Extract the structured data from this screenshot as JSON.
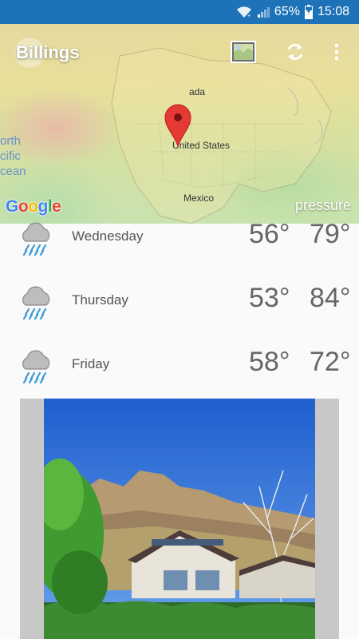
{
  "status_bar": {
    "battery_percent": "65%",
    "time": "15:08",
    "bg_color": "#1e73b8"
  },
  "map": {
    "city": "Billings",
    "labels": {
      "canada": "ada",
      "us": "United States",
      "mexico": "Mexico",
      "ocean_line1": "orth",
      "ocean_line2": "cific",
      "ocean_line3": "cean"
    },
    "google": "Google",
    "layer": "pressure",
    "icons": [
      "map-layers-icon",
      "refresh-icon",
      "more-vert-icon",
      "location-pin-icon"
    ]
  },
  "forecast": [
    {
      "day": "Wednesday",
      "low": "56°",
      "high": "79°",
      "icon": "rain-cloud-icon"
    },
    {
      "day": "Thursday",
      "low": "53°",
      "high": "84°",
      "icon": "rain-cloud-icon"
    },
    {
      "day": "Friday",
      "low": "58°",
      "high": "72°",
      "icon": "rain-cloud-icon"
    }
  ],
  "colors": {
    "accent": "#1e73b8",
    "pin": "#e53935",
    "rain": "#3a9bd9"
  }
}
